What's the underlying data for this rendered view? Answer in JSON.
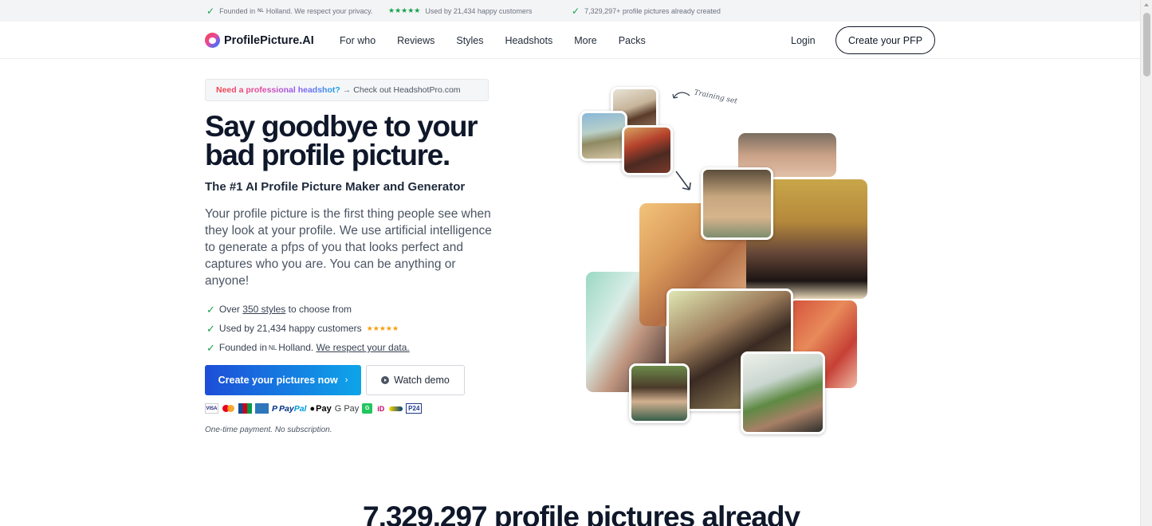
{
  "topbar": {
    "item1": "Founded in",
    "item1_nl": "NL",
    "item1_rest": "Holland. We respect your privacy.",
    "item2_stars": "★★★★★",
    "item2": "Used by 21,434 happy customers",
    "item3": "7,329,297+ profile pictures already created"
  },
  "nav": {
    "logo": "ProfilePicture.AI",
    "links": [
      "For who",
      "Reviews",
      "Styles",
      "Headshots",
      "More",
      "Packs"
    ],
    "login": "Login",
    "cta": "Create your PFP"
  },
  "hero": {
    "promo_highlight": "Need a professional headshot?",
    "promo_arrow": "→",
    "promo_text": "Check out HeadshotPro.com",
    "headline": "Say goodbye to your bad profile picture.",
    "subheadline": "The #1 AI Profile Picture Maker and Generator",
    "description": "Your profile picture is the first thing people see when they look at your profile. We use artificial intelligence to generate a pfps of you that looks perfect and captures who you are. You can be anything or anyone!",
    "features": {
      "f1_pre": "Over",
      "f1_link": "350 styles",
      "f1_post": "to choose from",
      "f2": "Used by 21,434 happy customers",
      "f2_stars": "★★★★★",
      "f3_pre": "Founded in",
      "f3_nl": "NL",
      "f3_mid": "Holland.",
      "f3_link": "We respect your data."
    },
    "primary_button": "Create your pictures now",
    "primary_chevron": "›",
    "demo_button": "Watch demo",
    "payments": {
      "visa": "VISA",
      "paypal_a": "Pay",
      "paypal_b": "Pal",
      "apple_pay": "Pay",
      "google_pay": "G Pay",
      "p24": "P24"
    },
    "note": "One-time payment. No subscription."
  },
  "collage": {
    "training_label": "Training set"
  },
  "stats": {
    "headline": "7,329,297 profile pictures already"
  },
  "colors": {
    "primary_gradient_start": "#1d4ed8",
    "primary_gradient_end": "#0ea5e9",
    "check_green": "#16a34a",
    "star_yellow": "#f59e0b"
  }
}
